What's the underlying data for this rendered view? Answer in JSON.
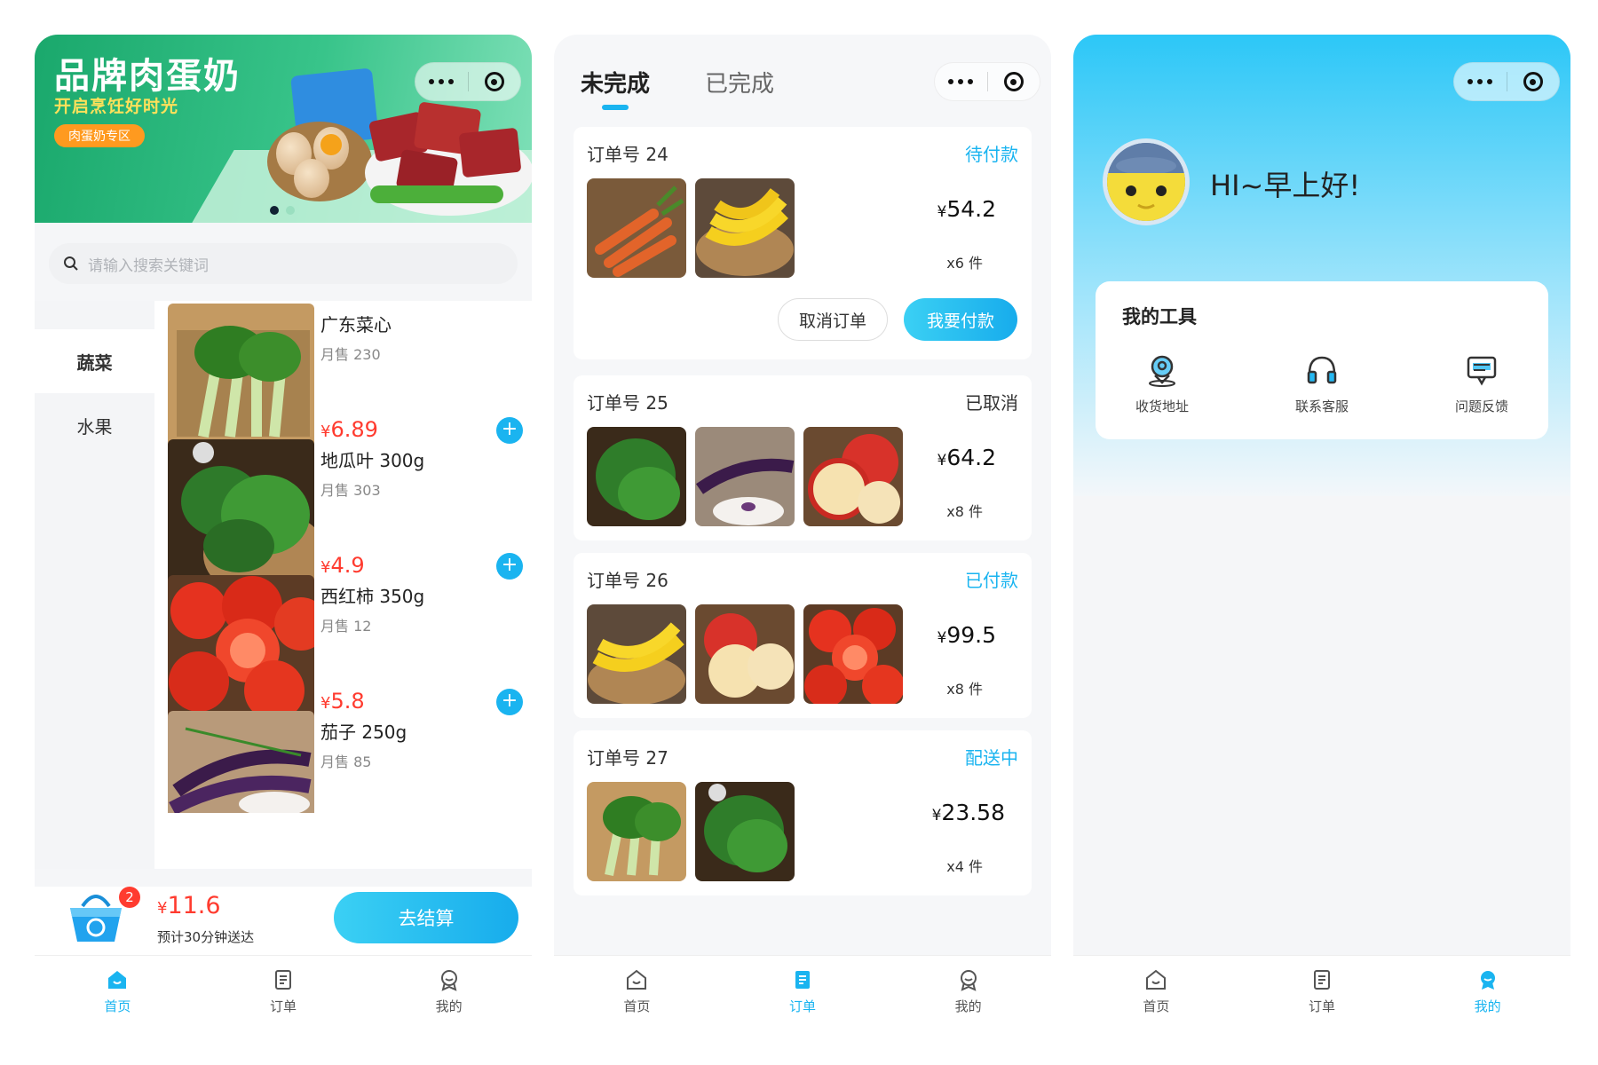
{
  "capsule": {
    "more_icon": "more-dots-icon",
    "close_icon": "target-circle-icon"
  },
  "tabbar": [
    {
      "label": "首页",
      "icon": "home-icon"
    },
    {
      "label": "订单",
      "icon": "order-icon"
    },
    {
      "label": "我的",
      "icon": "profile-icon"
    }
  ],
  "home": {
    "banner": {
      "title": "品牌肉蛋奶",
      "subtitle": "开启烹饪好时光",
      "tag": "肉蛋奶专区",
      "slides": 2,
      "current_slide": 1
    },
    "search": {
      "placeholder": "请输入搜索关键词"
    },
    "categories": [
      {
        "label": "蔬菜",
        "selected": true
      },
      {
        "label": "水果",
        "selected": false
      }
    ],
    "products": [
      {
        "name": "广东菜心",
        "sales": "月售 230",
        "price_symbol": "¥",
        "price": "6.89"
      },
      {
        "name": "地瓜叶 300g",
        "sales": "月售 303",
        "price_symbol": "¥",
        "price": "4.9"
      },
      {
        "name": "西红柿 350g",
        "sales": "月售 12",
        "price_symbol": "¥",
        "price": "5.8"
      },
      {
        "name": "茄子 250g",
        "sales": "月售 85"
      }
    ],
    "cart": {
      "count": "2",
      "price_symbol": "¥",
      "total": "11.6",
      "eta": "预计30分钟送达",
      "checkout_label": "去结算"
    }
  },
  "orders": {
    "tabs": [
      {
        "label": "未完成",
        "active": true
      },
      {
        "label": "已完成",
        "active": false
      }
    ],
    "items": [
      {
        "number": "订单号 24",
        "status": "待付款",
        "status_color": "#1ab4f0",
        "amount": "54.2",
        "count": "x6 件",
        "cancel_label": "取消订单",
        "pay_label": "我要付款"
      },
      {
        "number": "订单号 25",
        "status": "已取消",
        "status_color": "#333333",
        "amount": "64.2",
        "count": "x8 件"
      },
      {
        "number": "订单号 26",
        "status": "已付款",
        "status_color": "#1ab4f0",
        "amount": "99.5",
        "count": "x8 件"
      },
      {
        "number": "订单号 27",
        "status": "配送中",
        "status_color": "#1ab4f0",
        "amount": "23.58",
        "count": "x4 件"
      }
    ],
    "currency": "¥"
  },
  "profile": {
    "greeting": "HI~早上好!",
    "tools_title": "我的工具",
    "tools": [
      {
        "label": "收货地址",
        "icon": "location-icon"
      },
      {
        "label": "联系客服",
        "icon": "headset-icon"
      },
      {
        "label": "问题反馈",
        "icon": "feedback-icon"
      }
    ]
  },
  "colors": {
    "accent": "#1ab4f0",
    "price": "#ff3b2f",
    "banner_green": "#1aa86c"
  }
}
